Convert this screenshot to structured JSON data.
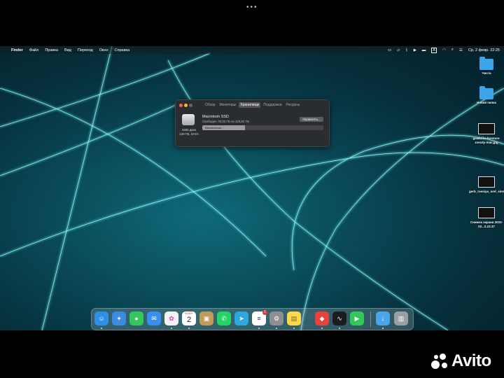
{
  "menubar": {
    "apple": "",
    "items": [
      "Finder",
      "Файл",
      "Правка",
      "Вид",
      "Переход",
      "Окно",
      "Справка"
    ],
    "status_icons": [
      "display-icon",
      "cast-icon",
      "bluetooth-icon",
      "play-icon",
      "battery-icon",
      "keyboard-layout-icon",
      "wifi-icon",
      "search-icon",
      "control-center-icon"
    ],
    "input_source": "А",
    "clock": "Ср, 2 февр.  22:25"
  },
  "window": {
    "tabs": [
      "Обзор",
      "Мониторы",
      "Хранилище",
      "Поддержка",
      "Ресурсы"
    ],
    "active_tab_index": 2,
    "disk_name": "Macintosh SSD",
    "disk_free": "Свободно 78,33 ГБ из 118,82 ГБ",
    "disk_caption_line1": "SSD-диск",
    "disk_caption_line2": "120 ГБ, SATA",
    "manage_button": "Управлять...",
    "bar_label": "Вычисление...",
    "bar_fraction": 0.35
  },
  "desktop_items": [
    {
      "label": "Чиста",
      "kind": "folder"
    },
    {
      "label": "Новая папка",
      "kind": "folder"
    },
    {
      "label": "galaktika-kosmos-zvezdy-mac.jpg",
      "kind": "image"
    },
    {
      "label": "gerb_rossiya_orel_simvoli...s720.jpg",
      "kind": "image"
    },
    {
      "label": "Снимок экрана 2022-02...2.23.37",
      "kind": "image"
    }
  ],
  "dock": {
    "apps": [
      {
        "name": "finder",
        "color": "#2f8fe8"
      },
      {
        "name": "safari",
        "color": "#3b8be0"
      },
      {
        "name": "messages",
        "color": "#34c759"
      },
      {
        "name": "mail",
        "color": "#3a8ef0"
      },
      {
        "name": "photos",
        "color": "#f2f2f2"
      },
      {
        "name": "calendar",
        "color": "#ffffff"
      },
      {
        "name": "contacts",
        "color": "#c49a5a"
      },
      {
        "name": "whatsapp",
        "color": "#25d366"
      },
      {
        "name": "telegram",
        "color": "#2ea6de"
      },
      {
        "name": "reminders",
        "color": "#ffffff"
      },
      {
        "name": "system-preferences",
        "color": "#8e8e93"
      },
      {
        "name": "notes",
        "color": "#ffd84a"
      },
      {
        "name": "anydesk",
        "color": "#e8433a"
      },
      {
        "name": "activity-monitor",
        "color": "#1c1c1c"
      },
      {
        "name": "facetime",
        "color": "#34c759"
      }
    ],
    "calendar_month": "ФЕВР.",
    "calendar_day": "2",
    "reminders_badge": "1",
    "right_items": [
      {
        "name": "downloads",
        "color": "#4aa6e8"
      },
      {
        "name": "trash",
        "color": "#9a9fa3"
      }
    ]
  },
  "watermark": {
    "text": "Avito"
  }
}
